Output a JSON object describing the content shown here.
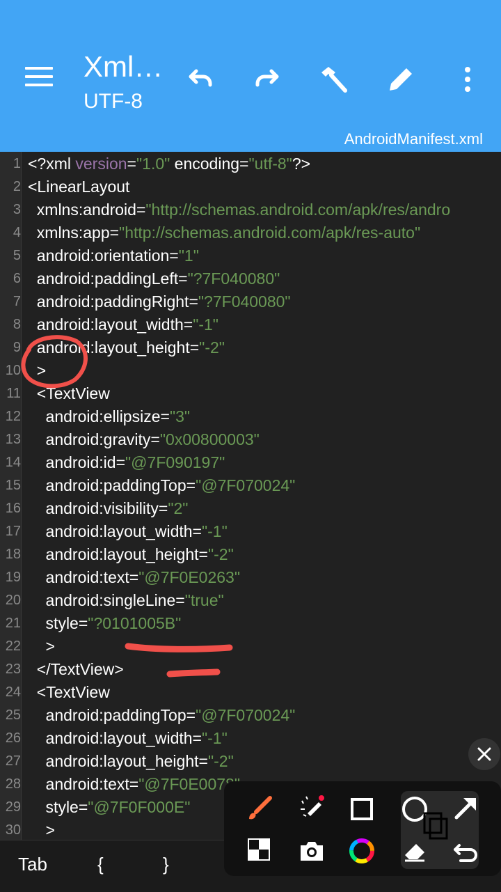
{
  "app": {
    "title": "Xml…",
    "subtitle": "UTF-8",
    "filename": "AndroidManifest.xml"
  },
  "toolbar": {
    "icons": [
      "menu-icon",
      "undo-icon",
      "redo-icon",
      "hammer-icon",
      "pencil-icon",
      "more-vert-icon"
    ]
  },
  "editor": {
    "lines": [
      {
        "n": "1",
        "parts": [
          [
            "t",
            "<?xml "
          ],
          [
            "d",
            "version"
          ],
          [
            "t",
            "="
          ],
          [
            "v",
            "\"1.0\""
          ],
          [
            "t",
            " encoding="
          ],
          [
            "v",
            "\"utf-8\""
          ],
          [
            "t",
            "?>"
          ]
        ]
      },
      {
        "n": "2",
        "parts": [
          [
            "t",
            "<LinearLayout"
          ]
        ]
      },
      {
        "n": "3",
        "parts": [
          [
            "t",
            "  xmlns:android="
          ],
          [
            "v",
            "\"http://schemas.android.com/apk/res/andro"
          ]
        ]
      },
      {
        "n": "4",
        "parts": [
          [
            "t",
            "  xmlns:app="
          ],
          [
            "v",
            "\"http://schemas.android.com/apk/res-auto\""
          ]
        ]
      },
      {
        "n": "5",
        "parts": [
          [
            "t",
            "  android:orientation="
          ],
          [
            "v",
            "\"1\""
          ]
        ]
      },
      {
        "n": "6",
        "parts": [
          [
            "t",
            "  android:paddingLeft="
          ],
          [
            "v",
            "\"?7F040080\""
          ]
        ]
      },
      {
        "n": "7",
        "parts": [
          [
            "t",
            "  android:paddingRight="
          ],
          [
            "v",
            "\"?7F040080\""
          ]
        ]
      },
      {
        "n": "8",
        "parts": [
          [
            "t",
            "  android:layout_width="
          ],
          [
            "v",
            "\"-1\""
          ]
        ]
      },
      {
        "n": "9",
        "parts": [
          [
            "t",
            "  android:layout_height="
          ],
          [
            "v",
            "\"-2\""
          ]
        ]
      },
      {
        "n": "10",
        "parts": [
          [
            "t",
            "  >"
          ]
        ]
      },
      {
        "n": "11",
        "parts": [
          [
            "t",
            "  <TextView"
          ]
        ]
      },
      {
        "n": "12",
        "parts": [
          [
            "t",
            "    android:ellipsize="
          ],
          [
            "v",
            "\"3\""
          ]
        ]
      },
      {
        "n": "13",
        "parts": [
          [
            "t",
            "    android:gravity="
          ],
          [
            "v",
            "\"0x00800003\""
          ]
        ]
      },
      {
        "n": "14",
        "parts": [
          [
            "t",
            "    android:id="
          ],
          [
            "v",
            "\"@7F090197\""
          ]
        ]
      },
      {
        "n": "15",
        "parts": [
          [
            "t",
            "    android:paddingTop="
          ],
          [
            "v",
            "\"@7F070024\""
          ]
        ]
      },
      {
        "n": "16",
        "parts": [
          [
            "t",
            "    android:visibility="
          ],
          [
            "v",
            "\"2\""
          ]
        ]
      },
      {
        "n": "17",
        "parts": [
          [
            "t",
            "    android:layout_width="
          ],
          [
            "v",
            "\"-1\""
          ]
        ]
      },
      {
        "n": "18",
        "parts": [
          [
            "t",
            "    android:layout_height="
          ],
          [
            "v",
            "\"-2\""
          ]
        ]
      },
      {
        "n": "19",
        "parts": [
          [
            "t",
            "    android:text="
          ],
          [
            "v",
            "\"@7F0E0263\""
          ]
        ]
      },
      {
        "n": "20",
        "parts": [
          [
            "t",
            "    android:singleLine="
          ],
          [
            "v",
            "\"true\""
          ]
        ]
      },
      {
        "n": "21",
        "parts": [
          [
            "t",
            "    style="
          ],
          [
            "v",
            "\"?0101005B\""
          ]
        ]
      },
      {
        "n": "22",
        "parts": [
          [
            "t",
            "    >"
          ]
        ]
      },
      {
        "n": "23",
        "parts": [
          [
            "t",
            "  </TextView>"
          ]
        ]
      },
      {
        "n": "24",
        "parts": [
          [
            "t",
            "  <TextView"
          ]
        ]
      },
      {
        "n": "25",
        "parts": [
          [
            "t",
            "    android:paddingTop="
          ],
          [
            "v",
            "\"@7F070024\""
          ]
        ]
      },
      {
        "n": "26",
        "parts": [
          [
            "t",
            "    android:layout_width="
          ],
          [
            "v",
            "\"-1\""
          ]
        ]
      },
      {
        "n": "27",
        "parts": [
          [
            "t",
            "    android:layout_height="
          ],
          [
            "v",
            "\"-2\""
          ]
        ]
      },
      {
        "n": "28",
        "parts": [
          [
            "t",
            "    android:text="
          ],
          [
            "v",
            "\"@7F0E0078\""
          ]
        ]
      },
      {
        "n": "29",
        "parts": [
          [
            "t",
            "    style="
          ],
          [
            "v",
            "\"@7F0F000E\""
          ]
        ]
      },
      {
        "n": "30",
        "parts": [
          [
            "t",
            "    >"
          ]
        ]
      }
    ]
  },
  "keyboard_bar": {
    "keys": [
      "Tab",
      "{",
      "}",
      "(",
      ")",
      ";"
    ]
  },
  "annotation_palette": {
    "tools": [
      "brush-icon",
      "magic-pen-icon",
      "rectangle-icon",
      "circle-icon",
      "arrow-icon",
      "mosaic-icon",
      "camera-icon",
      "color-wheel-icon",
      "eraser-icon",
      "undo-icon",
      "copy-icon",
      "close-icon"
    ]
  },
  "colors": {
    "appbar": "#42a5f5",
    "editor_bg": "#212121",
    "string_value": "#6a9955",
    "annotation_red": "#f0504a"
  }
}
